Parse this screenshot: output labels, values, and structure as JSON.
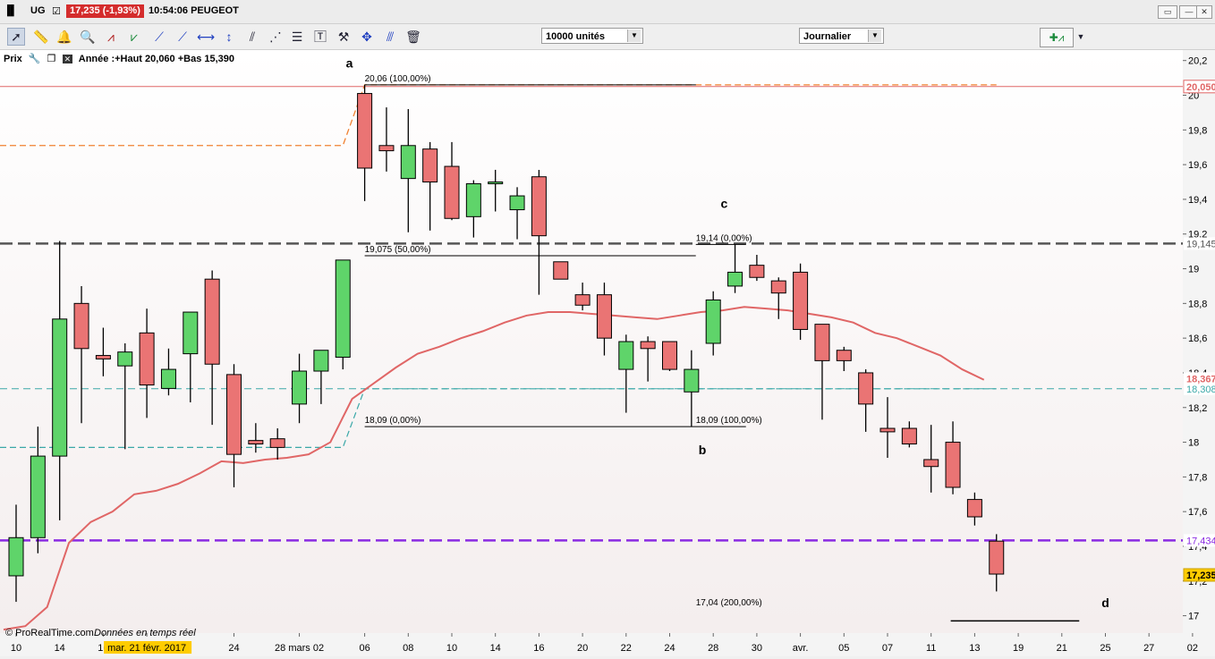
{
  "titlebar": {
    "symbol": "UG",
    "price_change": "17,235 (-1,93%)",
    "time_name": "10:54:06 PEUGEOT"
  },
  "toolbar": {
    "quantity": "10000 unités",
    "period": "Journalier"
  },
  "legend": {
    "prix": "Prix",
    "annee": "Année :+Haut 20,060 +Bas 15,390"
  },
  "footer": {
    "source": "© ProRealTime.com",
    "realtime": "Données en temps réel"
  },
  "colors": {
    "up": "#5fd46a",
    "down": "#ea7474",
    "ma": "#e06666",
    "orange": "#f08030",
    "teal": "#3aa8a8",
    "gray": "#555555",
    "purple": "#8a2be2",
    "highlight": "#ffcc00"
  },
  "chart_data": {
    "type": "candlestick",
    "ylim": [
      16.9,
      20.25
    ],
    "y_ticks": [
      17,
      17.2,
      17.4,
      17.6,
      17.8,
      18,
      18.2,
      18.4,
      18.6,
      18.8,
      19,
      19.2,
      19.4,
      19.6,
      19.8,
      20,
      20.2
    ],
    "y_tick_labels": [
      "17",
      "17,2",
      "17,4",
      "17,6",
      "17,8",
      "18",
      "18,2",
      "18,4",
      "18,6",
      "18,8",
      "19",
      "19,2",
      "19,4",
      "19,6",
      "19,8",
      "20",
      "20,2"
    ],
    "x_tick_labels": [
      "10",
      "14",
      "16",
      "mar. 21 févr. 2017",
      "24",
      "28 mars 02",
      "06",
      "08",
      "10",
      "14",
      "16",
      "20",
      "22",
      "24",
      "28",
      "30",
      "avr.",
      "05",
      "07",
      "11",
      "13",
      "19",
      "21",
      "25",
      "27",
      "02"
    ],
    "x_tick_slots": [
      0,
      2,
      4,
      6,
      10,
      13,
      16,
      18,
      20,
      22,
      24,
      26,
      28,
      30,
      32,
      34,
      36,
      38,
      40,
      42,
      44,
      46,
      48,
      50,
      52,
      54
    ],
    "highlight_tick": 3,
    "candles": [
      {
        "o": 17.23,
        "h": 17.64,
        "l": 17.08,
        "c": 17.45
      },
      {
        "o": 17.45,
        "h": 18.09,
        "l": 17.36,
        "c": 17.92
      },
      {
        "o": 17.92,
        "h": 19.16,
        "l": 17.55,
        "c": 18.71
      },
      {
        "o": 18.8,
        "h": 18.9,
        "l": 18.11,
        "c": 18.54
      },
      {
        "o": 18.5,
        "h": 18.66,
        "l": 18.38,
        "c": 18.48
      },
      {
        "o": 18.44,
        "h": 18.57,
        "l": 17.96,
        "c": 18.52
      },
      {
        "o": 18.63,
        "h": 18.77,
        "l": 18.14,
        "c": 18.33
      },
      {
        "o": 18.31,
        "h": 18.54,
        "l": 18.27,
        "c": 18.42
      },
      {
        "o": 18.51,
        "h": 18.74,
        "l": 18.23,
        "c": 18.75
      },
      {
        "o": 18.94,
        "h": 18.99,
        "l": 18.1,
        "c": 18.45
      },
      {
        "o": 18.39,
        "h": 18.45,
        "l": 17.74,
        "c": 17.93
      },
      {
        "o": 18.01,
        "h": 18.11,
        "l": 17.94,
        "c": 17.99
      },
      {
        "o": 18.02,
        "h": 18.08,
        "l": 17.9,
        "c": 17.97
      },
      {
        "o": 18.22,
        "h": 18.51,
        "l": 18.11,
        "c": 18.41
      },
      {
        "o": 18.41,
        "h": 18.53,
        "l": 18.22,
        "c": 18.53
      },
      {
        "o": 18.49,
        "h": 19.05,
        "l": 18.42,
        "c": 19.05
      },
      {
        "o": 20.01,
        "h": 20.06,
        "l": 19.39,
        "c": 19.58
      },
      {
        "o": 19.71,
        "h": 19.93,
        "l": 19.56,
        "c": 19.68
      },
      {
        "o": 19.52,
        "h": 19.92,
        "l": 19.21,
        "c": 19.71
      },
      {
        "o": 19.69,
        "h": 19.73,
        "l": 19.22,
        "c": 19.5
      },
      {
        "o": 19.59,
        "h": 19.73,
        "l": 19.28,
        "c": 19.29
      },
      {
        "o": 19.3,
        "h": 19.51,
        "l": 19.18,
        "c": 19.49
      },
      {
        "o": 19.5,
        "h": 19.57,
        "l": 19.33,
        "c": 19.5
      },
      {
        "o": 19.34,
        "h": 19.47,
        "l": 19.17,
        "c": 19.42
      },
      {
        "o": 19.53,
        "h": 19.57,
        "l": 18.85,
        "c": 19.19
      },
      {
        "o": 19.04,
        "h": 19.04,
        "l": 18.94,
        "c": 18.94
      },
      {
        "o": 18.85,
        "h": 18.92,
        "l": 18.76,
        "c": 18.79
      },
      {
        "o": 18.85,
        "h": 18.92,
        "l": 18.5,
        "c": 18.6
      },
      {
        "o": 18.42,
        "h": 18.62,
        "l": 18.17,
        "c": 18.58
      },
      {
        "o": 18.58,
        "h": 18.61,
        "l": 18.35,
        "c": 18.54
      },
      {
        "o": 18.58,
        "h": 18.58,
        "l": 18.41,
        "c": 18.42
      },
      {
        "o": 18.29,
        "h": 18.53,
        "l": 18.09,
        "c": 18.42
      },
      {
        "o": 18.57,
        "h": 18.87,
        "l": 18.5,
        "c": 18.82
      },
      {
        "o": 18.9,
        "h": 19.14,
        "l": 18.86,
        "c": 18.98
      },
      {
        "o": 19.02,
        "h": 19.08,
        "l": 18.93,
        "c": 18.95
      },
      {
        "o": 18.93,
        "h": 18.95,
        "l": 18.71,
        "c": 18.86
      },
      {
        "o": 18.98,
        "h": 19.03,
        "l": 18.59,
        "c": 18.65
      },
      {
        "o": 18.68,
        "h": 18.68,
        "l": 18.13,
        "c": 18.47
      },
      {
        "o": 18.53,
        "h": 18.55,
        "l": 18.41,
        "c": 18.47
      },
      {
        "o": 18.4,
        "h": 18.42,
        "l": 18.06,
        "c": 18.22
      },
      {
        "o": 18.08,
        "h": 18.26,
        "l": 17.91,
        "c": 18.06
      },
      {
        "o": 18.08,
        "h": 18.12,
        "l": 17.97,
        "c": 17.99
      },
      {
        "o": 17.9,
        "h": 18.1,
        "l": 17.71,
        "c": 17.86
      },
      {
        "o": 18.0,
        "h": 18.12,
        "l": 17.7,
        "c": 17.74
      },
      {
        "o": 17.67,
        "h": 17.71,
        "l": 17.52,
        "c": 17.57
      },
      {
        "o": 17.43,
        "h": 17.47,
        "l": 17.14,
        "c": 17.24
      }
    ],
    "ma": [
      16.92,
      16.94,
      17.05,
      17.42,
      17.54,
      17.6,
      17.7,
      17.72,
      17.76,
      17.82,
      17.89,
      17.88,
      17.9,
      17.91,
      17.93,
      18.0,
      18.25,
      18.34,
      18.43,
      18.51,
      18.55,
      18.6,
      18.64,
      18.69,
      18.73,
      18.75,
      18.75,
      18.74,
      18.73,
      18.72,
      18.71,
      18.73,
      18.75,
      18.76,
      18.78,
      18.77,
      18.76,
      18.74,
      18.72,
      18.69,
      18.63,
      18.6,
      18.55,
      18.5,
      18.42,
      18.36
    ],
    "level_lines": [
      {
        "y": 20.05,
        "label": "20,050",
        "color": "#e06666",
        "style": "solid"
      },
      {
        "y": 19.145,
        "label": "19,145",
        "color": "#555555",
        "style": "dashed"
      },
      {
        "y": 18.308,
        "label": "18,308",
        "color": "#3aa8a8",
        "style": "dashed"
      },
      {
        "y": 17.434,
        "label": "17,434",
        "color": "#8a2be2",
        "style": "dashed"
      }
    ],
    "side_labels": [
      {
        "y": 18.367,
        "label": "18,367",
        "color": "#e06666"
      },
      {
        "y": 17.235,
        "label": "17,235",
        "color": "#000000",
        "bg": "#ffcc00"
      }
    ],
    "fib_lines": [
      {
        "y": 20.06,
        "label": "20,06 (100,00%)",
        "x0": 16,
        "x1": 32
      },
      {
        "y": 19.075,
        "label": "19,075 (50,00%)",
        "x0": 16,
        "x1": 32
      },
      {
        "y": 18.09,
        "label": "18,09 (0,00%)",
        "x0": 16,
        "x1": 32
      },
      {
        "y": 18.09,
        "label": "18,09 (100,00%)",
        "x0": 32,
        "x1": 33
      },
      {
        "y": 19.14,
        "label": "19,14 (0,00%)",
        "x0": 32,
        "x1": 33
      },
      {
        "y": 17.04,
        "label": "17,04 (200,00%)",
        "x0": 32,
        "x1": 33
      }
    ],
    "points": [
      {
        "label": "a",
        "slot": 15.3,
        "y": 20.16
      },
      {
        "label": "b",
        "slot": 31.5,
        "y": 17.93
      },
      {
        "label": "c",
        "slot": 32.5,
        "y": 19.35
      },
      {
        "label": "d",
        "slot": 50,
        "y": 17.05
      }
    ]
  }
}
